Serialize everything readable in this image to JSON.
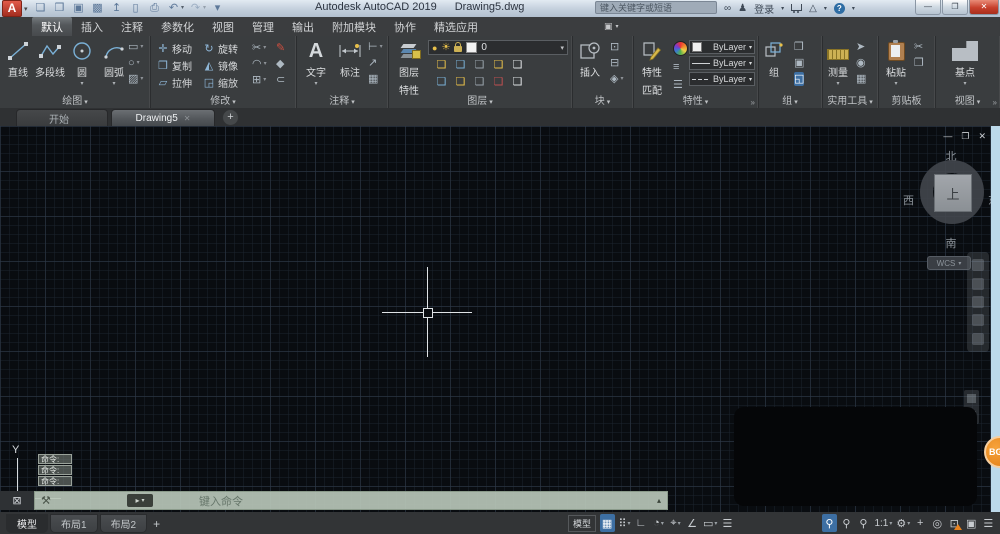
{
  "glyphs": {
    "dropdown": "▾",
    "close": "✕",
    "minimize": "—",
    "maximize": "❐",
    "help": "?",
    "launcher": "»",
    "app_letter": "A",
    "search": "∞",
    "person": "♟",
    "triangle": "△"
  },
  "title_bar": {
    "product": "Autodesk AutoCAD 2019",
    "document": "Drawing5.dwg",
    "search_placeholder": "键入关键字或短语",
    "sign_in": "登录",
    "qat_icons": [
      {
        "name": "new-file-icon",
        "glyph": "❏"
      },
      {
        "name": "open-file-icon",
        "glyph": "❒"
      },
      {
        "name": "save-icon",
        "glyph": "▣"
      },
      {
        "name": "save-as-icon",
        "glyph": "▩"
      },
      {
        "name": "upload-icon",
        "glyph": "↥"
      },
      {
        "name": "mobile-publish-icon",
        "glyph": "▯"
      },
      {
        "name": "print-icon",
        "glyph": "⎙"
      },
      {
        "name": "undo-icon",
        "glyph": "↶",
        "ddg": "▾"
      },
      {
        "name": "redo-icon",
        "glyph": "↷",
        "ddg": "▾",
        "dim": true
      },
      {
        "name": "qat-customize-icon",
        "glyph": "▾"
      }
    ]
  },
  "ribbon_tabs": [
    {
      "label": "默认",
      "active": true
    },
    {
      "label": "插入"
    },
    {
      "label": "注释"
    },
    {
      "label": "参数化"
    },
    {
      "label": "视图"
    },
    {
      "label": "管理"
    },
    {
      "label": "输出"
    },
    {
      "label": "附加模块"
    },
    {
      "label": "协作"
    },
    {
      "label": "精选应用"
    }
  ],
  "menubar_extra": {
    "glyph": "▣",
    "ddg": "▾"
  },
  "panels": {
    "draw": {
      "label": "绘图",
      "line_label": "直线",
      "polyline_label": "多段线",
      "circle_label": "圆",
      "arc_label": "圆弧",
      "small": [
        {
          "name": "rectangle-icon",
          "glyph": "▭",
          "ddg": "▾"
        },
        {
          "name": "ellipse-icon",
          "glyph": "○",
          "ddg": "▾"
        },
        {
          "name": "hatch-icon",
          "glyph": "▨",
          "ddg": "▾"
        }
      ]
    },
    "modify": {
      "label": "修改",
      "grid": [
        {
          "name": "move-button",
          "glyph": "✛",
          "label": "移动"
        },
        {
          "name": "copy-button",
          "glyph": "❐",
          "label": "复制"
        },
        {
          "name": "stretch-button",
          "glyph": "▱",
          "label": "拉伸"
        },
        {
          "name": "rotate-button",
          "glyph": "↻",
          "label": "旋转"
        },
        {
          "name": "mirror-button",
          "glyph": "◭",
          "label": "镜像"
        },
        {
          "name": "scale-button",
          "glyph": "◲",
          "label": "缩放"
        }
      ],
      "small": [
        {
          "name": "trim-icon",
          "glyph": "✂",
          "ddg": "▾"
        },
        {
          "name": "fillet-icon",
          "glyph": "◠",
          "ddg": "▾"
        },
        {
          "name": "array-icon",
          "glyph": "⊞",
          "ddg": "▾"
        }
      ],
      "extra": [
        {
          "name": "erase-icon",
          "glyph": "✎",
          "red": true
        },
        {
          "name": "explode-icon",
          "glyph": "◆"
        },
        {
          "name": "join-icon",
          "glyph": "⊂"
        }
      ]
    },
    "annotate": {
      "label": "注释",
      "text_label": "文字",
      "dim_label": "标注",
      "small": [
        {
          "name": "multileader-icon",
          "glyph": "⊢",
          "ddg": "▾"
        },
        {
          "name": "leader-icon",
          "glyph": "↗"
        },
        {
          "name": "table-icon",
          "glyph": "▦"
        }
      ]
    },
    "layers": {
      "label": "图层",
      "props_label_1": "图层",
      "props_label_2": "特性",
      "bulb_glyph": "●",
      "sun_glyph": "☀",
      "current_layer": "0",
      "tools": [
        {
          "name": "layer-tool-icon",
          "glyph": "❏",
          "c": "y"
        },
        {
          "name": "layer-tool-icon",
          "glyph": "❏",
          "c": "b"
        },
        {
          "name": "layer-tool-icon",
          "glyph": "❏",
          "c": "g"
        },
        {
          "name": "layer-tool-icon",
          "glyph": "❏",
          "c": "y"
        },
        {
          "name": "layer-tool-icon",
          "glyph": "❏",
          "c": "w"
        },
        {
          "name": "layer-tool-icon",
          "glyph": "❏",
          "c": "b"
        },
        {
          "name": "layer-tool-icon",
          "glyph": "❏",
          "c": "y"
        },
        {
          "name": "layer-tool-icon",
          "glyph": "❏",
          "c": "g"
        },
        {
          "name": "layer-tool-icon",
          "glyph": "❏",
          "c": "r"
        },
        {
          "name": "layer-tool-icon",
          "glyph": "❏",
          "c": "w"
        }
      ]
    },
    "block": {
      "label": "块",
      "insert_label": "插入",
      "small": [
        {
          "name": "create-block-icon",
          "glyph": "⊡"
        },
        {
          "name": "write-block-icon",
          "glyph": "⊟"
        },
        {
          "name": "block-attribute-icon",
          "glyph": "◈",
          "ddg": "▾"
        }
      ]
    },
    "properties": {
      "label": "特性",
      "match_label_1": "特性",
      "match_label_2": "匹配",
      "color_value": "ByLayer",
      "lineweight_value": "ByLayer",
      "linetype_value": "ByLayer",
      "side": [
        {
          "name": "color-wheel-icon",
          "wheel": true
        },
        {
          "name": "lineweight-list-icon",
          "glyph": "≡"
        },
        {
          "name": "linetype-list-icon",
          "glyph": "☰"
        }
      ]
    },
    "group": {
      "label": "组",
      "group_label": "组",
      "small": [
        {
          "name": "ungroup-icon",
          "glyph": "❒"
        },
        {
          "name": "group-edit-icon",
          "glyph": "▣"
        },
        {
          "name": "group-select-icon",
          "glyph": "◱",
          "active": true
        }
      ]
    },
    "utilities": {
      "label": "实用工具",
      "measure_label": "测量",
      "small": [
        {
          "name": "quick-select-icon",
          "glyph": "➤"
        },
        {
          "name": "point-id-icon",
          "glyph": "◉"
        },
        {
          "name": "calculator-icon",
          "glyph": "▦"
        }
      ]
    },
    "clipboard": {
      "label": "剪贴板",
      "paste_label": "粘贴",
      "small": [
        {
          "name": "cut-icon",
          "glyph": "✂"
        },
        {
          "name": "copy-clip-icon",
          "glyph": "❐"
        }
      ]
    },
    "view": {
      "label": "视图",
      "base_label": "基点"
    }
  },
  "file_tabs": {
    "tabs": [
      {
        "label": "开始"
      },
      {
        "label": "Drawing5",
        "active": true,
        "close_glyph": "✕"
      }
    ],
    "add_glyph": "+"
  },
  "drawing": {
    "viewcube": {
      "north": "北",
      "south": "南",
      "west": "西",
      "east": "东",
      "top": "上",
      "wcs": "WCS",
      "wcs_dd": "▾"
    },
    "ucs_y_label": "Y",
    "badge": "BG"
  },
  "command": {
    "history": [
      {
        "text": "命令:"
      },
      {
        "text": "命令:"
      },
      {
        "text": "命令:"
      }
    ],
    "placeholder": "键入命令",
    "dock_glyph": "⊠",
    "wrench_glyph": "⚒",
    "recent_glyph": "▸",
    "recent_dd": "▾",
    "handle_glyph": "▴"
  },
  "status_bar": {
    "layout_tabs": [
      {
        "label": "模型",
        "active": true
      },
      {
        "label": "布局1"
      },
      {
        "label": "布局2"
      }
    ],
    "add_glyph": "+",
    "model_label": "模型",
    "icons": [
      {
        "name": "grid-display-icon",
        "glyph": "▦",
        "active": true
      },
      {
        "name": "snap-mode-icon",
        "glyph": "⠿",
        "ddg": "▾"
      },
      {
        "name": "ortho-mode-icon",
        "glyph": "∟"
      },
      {
        "name": "polar-tracking-icon",
        "glyph": "◔",
        "ddg": "▾"
      },
      {
        "name": "object-snap-icon",
        "glyph": "⌖",
        "ddg": "▾"
      },
      {
        "name": "isodraft-icon",
        "glyph": "∠"
      },
      {
        "name": "dynamic-input-icon",
        "glyph": "▭",
        "ddg": "▾"
      },
      {
        "name": "lineweight-icon",
        "glyph": "☰"
      },
      {
        "name": "annotation-visibility-icon",
        "glyph": "⚲",
        "active": true,
        "gap": true
      },
      {
        "name": "annotation-autoscale-icon",
        "glyph": "⚲"
      },
      {
        "name": "annotation-scale-person-icon",
        "glyph": "⚲"
      },
      {
        "name": "annotation-scale-value",
        "text": "1:1",
        "ddg": "▾"
      },
      {
        "name": "workspace-switch-icon",
        "glyph": "⚙",
        "ddg": "▾"
      },
      {
        "name": "move-ui-icon",
        "glyph": "+"
      },
      {
        "name": "isolate-objects-icon",
        "glyph": "◎"
      },
      {
        "name": "graphics-performance-icon",
        "glyph": "⊡",
        "warn": true
      },
      {
        "name": "clean-screen-icon",
        "glyph": "▣"
      },
      {
        "name": "customize-icon",
        "glyph": "☰"
      }
    ]
  },
  "colors": {
    "accent_blue": "#3d6fa3",
    "close_red": "#c7402c",
    "canvas_bg": "#090c10",
    "command_bar_green": "#b7c6b7",
    "badge_orange": "#e8821e",
    "scrollbar_blue": "#bcd9ea"
  }
}
